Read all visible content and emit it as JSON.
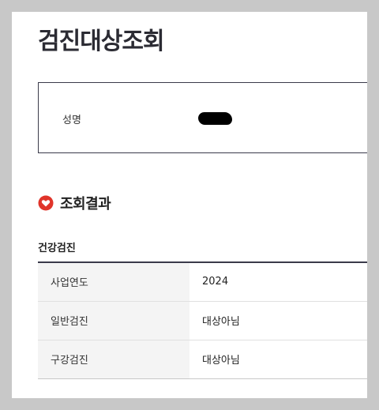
{
  "page": {
    "title": "검진대상조회"
  },
  "info": {
    "name_label": "성명"
  },
  "result": {
    "section_title": "조회결과",
    "subsection_title": "건강검진",
    "rows": [
      {
        "label": "사업연도",
        "value": "2024"
      },
      {
        "label": "일반검진",
        "value": "대상아님"
      },
      {
        "label": "구강검진",
        "value": "대상아님"
      }
    ]
  },
  "colors": {
    "accent_icon": "#e0342a",
    "border": "#3a3a4a"
  }
}
